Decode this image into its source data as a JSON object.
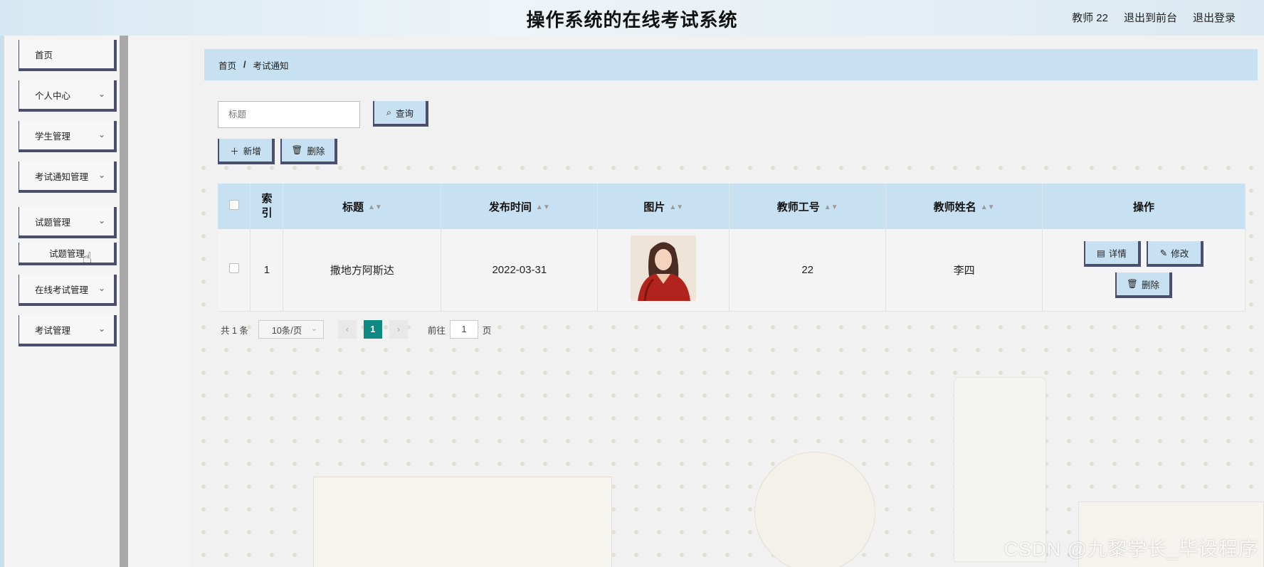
{
  "header": {
    "title": "操作系统的在线考试系统",
    "user": "教师 22",
    "exit_front": "退出到前台",
    "logout": "退出登录"
  },
  "sidebar": {
    "items": [
      {
        "label": "首页"
      },
      {
        "label": "个人中心"
      },
      {
        "label": "学生管理"
      },
      {
        "label": "考试通知管理"
      },
      {
        "label": "试题管理"
      },
      {
        "label": "在线考试管理"
      },
      {
        "label": "考试管理"
      }
    ],
    "submenu": {
      "label": "试题管理"
    }
  },
  "breadcrumb": {
    "home": "首页",
    "sep": "/",
    "current": "考试通知"
  },
  "search": {
    "placeholder": "标题",
    "button": "查询"
  },
  "toolbar": {
    "add": "新增",
    "delete": "删除"
  },
  "table": {
    "headers": {
      "index": "索引",
      "title": "标题",
      "publish_time": "发布时间",
      "image": "图片",
      "teacher_id": "教师工号",
      "teacher_name": "教师姓名",
      "ops": "操作"
    },
    "rows": [
      {
        "index": "1",
        "title": "撒地方阿斯达",
        "publish_time": "2022-03-31",
        "teacher_id": "22",
        "teacher_name": "李四"
      }
    ],
    "ops": {
      "detail": "详情",
      "edit": "修改",
      "delete": "删除"
    }
  },
  "pagination": {
    "total": "共 1 条",
    "page_size": "10条/页",
    "current": "1",
    "goto_label": "前往",
    "goto_value": "1",
    "page_suffix": "页"
  },
  "watermark": "CSDN @九黎学长_毕设程序",
  "colors": {
    "accent": "#c8e1f2",
    "border": "#4b4e6d",
    "page_active": "#0f8a82"
  }
}
